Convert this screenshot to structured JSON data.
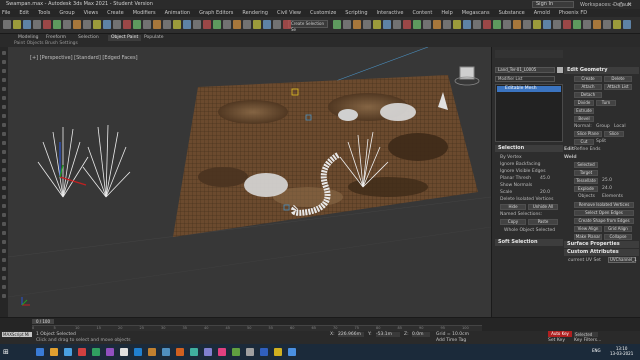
{
  "titlebar": {
    "title": "Swampan.max - Autodesk 3ds Max 2021 - Student Version",
    "sign_in": "Sign In",
    "workspace_label": "Workspaces:",
    "workspace_value": "Default"
  },
  "menu": [
    "File",
    "Edit",
    "Tools",
    "Group",
    "Views",
    "Create",
    "Modifiers",
    "Animation",
    "Graph Editors",
    "Rendering",
    "Civil View",
    "Customize",
    "Scripting",
    "Interactive",
    "Content",
    "Help",
    "Megascans",
    "Substance",
    "Arnold",
    "Phoenix FD"
  ],
  "toolbar": {
    "selection_set": "Create Selection Se"
  },
  "ribbon": {
    "tabs": [
      "Modeling",
      "Freeform",
      "Selection",
      "Object Paint",
      "Populate"
    ],
    "active_tab": "Object Paint",
    "sub": "Paint Objects   Brush Settings"
  },
  "viewport": {
    "label": "[+] [Perspective] [Standard] [Edged Faces]"
  },
  "panel": {
    "object_name": "Land_Ter-01_L0005",
    "modifier_list": "Modifier List",
    "stack_item": "Editable Mesh",
    "edit_geometry": "Edit Geometry",
    "create": "Create",
    "delete": "Delete",
    "attach": "Attach",
    "attach_list": "Attach List",
    "detach": "Detach",
    "divide": "Divide",
    "turn": "Turn",
    "extrude": "Extrude",
    "bevel": "Bevel",
    "normal_label": "Normal:",
    "group": "Group",
    "local": "Local",
    "slice_plane": "Slice Plane",
    "slice": "Slice",
    "cut": "Cut",
    "split": "Split",
    "refine_ends": "Refine Ends",
    "weld": "Weld",
    "selected": "Selected",
    "target": "Target",
    "tessellate": "Tessellate",
    "tess_value": "25.0",
    "explode": "Explode",
    "explode_value": "24.0",
    "objects": "Objects",
    "elements": "Elements",
    "remove_isolated": "Remove Isolated Vertices",
    "select_open_edges": "Select Open Edges",
    "create_shape": "Create Shape from Edges",
    "view_align": "View Align",
    "grid_align": "Grid Align",
    "make_planar": "Make Planar",
    "collapse": "Collapse",
    "surface_properties": "Surface Properties",
    "custom_attributes": "Custom Attributes",
    "current_uv_label": "current UV Set",
    "current_uv_value": "UVChannel_1",
    "selection_head": "Selection",
    "by_vertex": "By Vertex",
    "ignore_backfacing": "Ignore Backfacing",
    "ignore_visible_edges": "Ignore Visible Edges",
    "planar_thresh": "Planar Thresh",
    "planar_value": "45.0",
    "show_normals": "Show Normals",
    "scale": "Scale",
    "scale_value": "20.0",
    "delete_isolated": "Delete Isolated Vertices",
    "hide": "Hide",
    "unhide_all": "Unhide All",
    "named_selections": "Named Selections:",
    "copy": "Copy",
    "paste": "Paste",
    "whole_selected": "Whole Object Selected",
    "soft_selection": "Soft Selection",
    "edit_head": "Edit"
  },
  "timeline": {
    "frame": "0 / 100",
    "ticks": [
      "0",
      "5",
      "10",
      "15",
      "20",
      "25",
      "30",
      "35",
      "40",
      "45",
      "50",
      "55",
      "60",
      "65",
      "70",
      "75",
      "80",
      "85",
      "90",
      "95",
      "100"
    ]
  },
  "status": {
    "max_script": "MAXScript Mi",
    "selected": "1 Object Selected",
    "hint": "Click and drag to select and move objects",
    "x_label": "X:",
    "x_value": "226.966m",
    "y_label": "Y:",
    "y_value": "-53.1m",
    "z_label": "Z:",
    "z_value": "0.0m",
    "grid": "Grid = 10.0cm",
    "add_time_tag": "Add Time Tag",
    "auto_key": "Auto Key",
    "selected_label": "Selected",
    "set_key": "Set Key",
    "key_filters": "Key Filters...",
    "frame_value": "0"
  },
  "taskbar": {
    "time": "13:10",
    "date": "13-03-2021",
    "lang": "ENG"
  },
  "colors": {
    "accent": "#3b74c0",
    "terrain": "#6b4a2e",
    "viewport_bg": "#373737",
    "auto_key": "#b02020"
  }
}
